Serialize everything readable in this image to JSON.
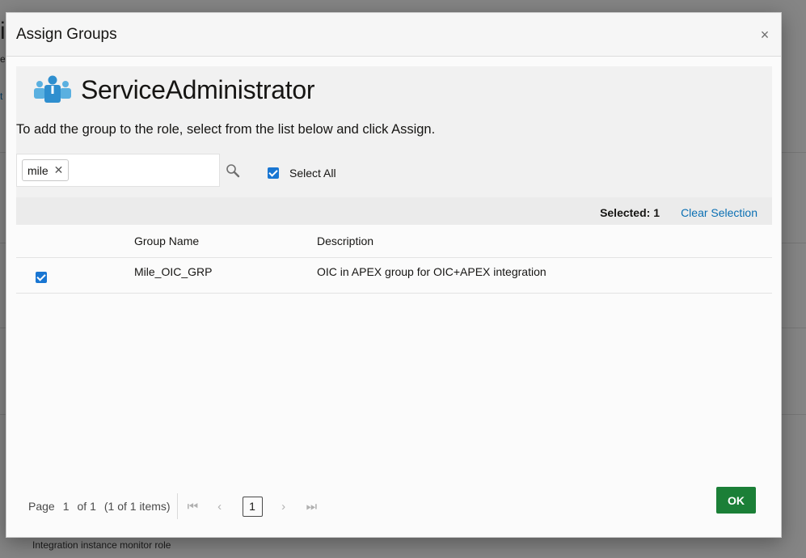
{
  "background": {
    "fragments": [
      "i",
      "e",
      "t"
    ],
    "footer_text": "Integration instance monitor role"
  },
  "dialog": {
    "title": "Assign Groups",
    "close_glyph": "×",
    "role": {
      "name": "ServiceAdministrator",
      "icon": "group-users-icon"
    },
    "instruction": "To add the group to the role, select from the list below and click Assign.",
    "search": {
      "chip_label": "mile",
      "chip_remove_glyph": "✕",
      "icon": "search-icon"
    },
    "select_all": {
      "label": "Select All",
      "checked": true
    },
    "selection": {
      "count_text": "Selected: 1",
      "clear_label": "Clear Selection"
    },
    "table": {
      "columns": [
        "",
        "Group Name",
        "Description"
      ],
      "rows": [
        {
          "checked": true,
          "name": "Mile_OIC_GRP",
          "description": "OIC in APEX group for OIC+APEX integration"
        }
      ]
    },
    "pager": {
      "page_label": "Page",
      "page_number": "1",
      "of_total": "of 1",
      "items_text": "(1 of 1 items)",
      "current_page": "1"
    },
    "ok_label": "OK"
  },
  "colors": {
    "accent_blue": "#1976d2",
    "link_blue": "#0a6fb3",
    "ok_green": "#1b7f37",
    "icon_blue": "#2f8fcf"
  }
}
